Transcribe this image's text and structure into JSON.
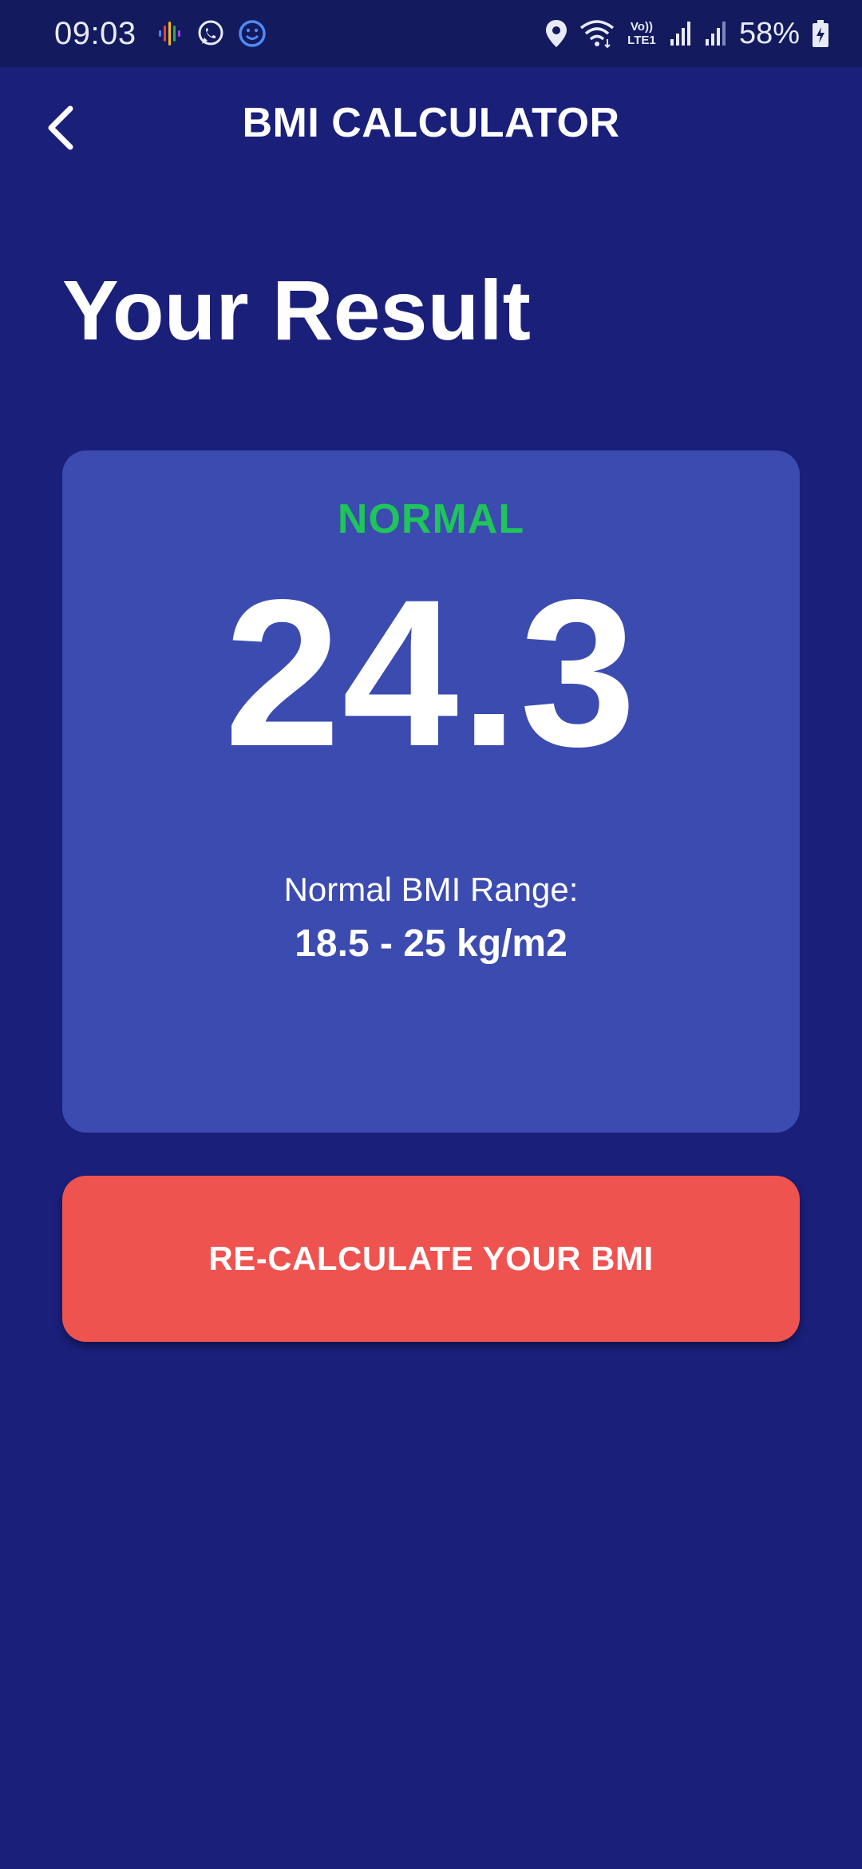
{
  "status_bar": {
    "time": "09:03",
    "battery_percent": "58%",
    "network_label": "Vo)) LTE1",
    "icons": [
      "podcasts-icon",
      "whatsapp-icon",
      "smiley-icon",
      "location-icon",
      "wifi-icon",
      "volte-icon",
      "signal-icon",
      "signal-icon-2",
      "battery-icon"
    ]
  },
  "app_bar": {
    "title": "BMI CALCULATOR",
    "back_icon": "chevron-left-icon"
  },
  "page": {
    "title": "Your Result"
  },
  "result": {
    "status": "NORMAL",
    "value": "24.3",
    "range_label": "Normal BMI Range:",
    "range_value": "18.5 - 25 kg/m2"
  },
  "actions": {
    "recalculate_label": "RE-CALCULATE YOUR BMI"
  },
  "colors": {
    "background": "#1a1f7a",
    "status_bar": "#131a5e",
    "card": "#3b4bb0",
    "status_normal": "#1fc45a",
    "button": "#ef5350"
  }
}
